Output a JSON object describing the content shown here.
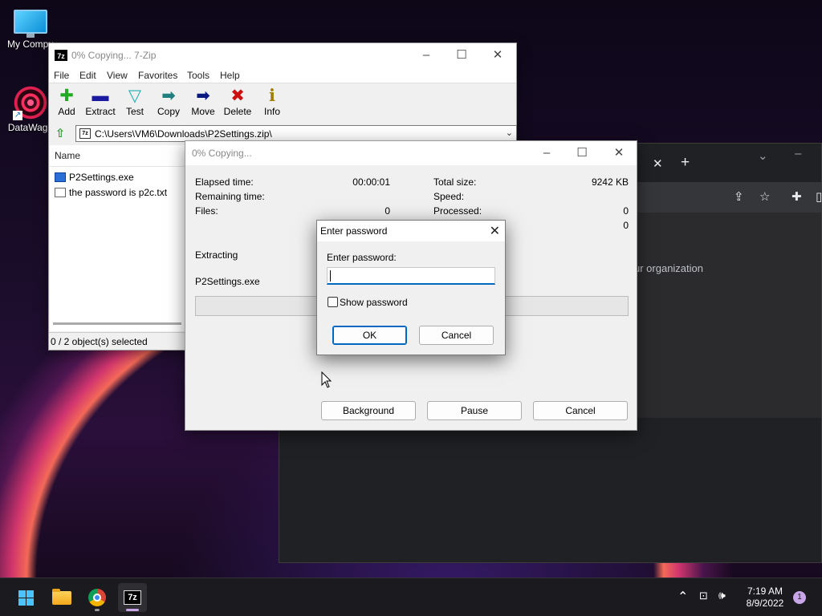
{
  "desktop": {
    "icons": [
      {
        "label": "My Compu",
        "icon": "monitor-icon"
      },
      {
        "label": "DataWago",
        "icon": "app-shortcut-icon"
      }
    ]
  },
  "browser": {
    "text_fragment": "ur organization",
    "icons": [
      "close-icon",
      "new-tab-icon",
      "share-icon",
      "star-icon",
      "extensions-icon"
    ]
  },
  "zip_window": {
    "title": "0% Copying... 7-Zip",
    "app_icon_text": "7z",
    "menu": [
      "File",
      "Edit",
      "View",
      "Favorites",
      "Tools",
      "Help"
    ],
    "toolbar": [
      {
        "label": "Add",
        "icon": "plus-icon",
        "color": "#22aa22"
      },
      {
        "label": "Extract",
        "icon": "minus-icon",
        "color": "#1a1aa0"
      },
      {
        "label": "Test",
        "icon": "check-icon",
        "color": "#20b0b0"
      },
      {
        "label": "Copy",
        "icon": "copy-arrow-icon",
        "color": "#208080"
      },
      {
        "label": "Move",
        "icon": "move-arrow-icon",
        "color": "#0a1a80"
      },
      {
        "label": "Delete",
        "icon": "delete-x-icon",
        "color": "#cc1010"
      },
      {
        "label": "Info",
        "icon": "info-icon",
        "color": "#a08000"
      }
    ],
    "address": "C:\\Users\\VM6\\Downloads\\P2Settings.zip\\",
    "column_header": "Name",
    "files": [
      {
        "name": "P2Settings.exe",
        "type": "exe"
      },
      {
        "name": "the password is p2c.txt",
        "type": "txt"
      }
    ],
    "status": "0 / 2 object(s) selected"
  },
  "progress_dialog": {
    "title": "0% Copying...",
    "elapsed_label": "Elapsed time:",
    "elapsed_value": "00:00:01",
    "remaining_label": "Remaining time:",
    "files_label": "Files:",
    "files_value": "0",
    "total_size_label": "Total size:",
    "total_size_value": "9242 KB",
    "speed_label": "Speed:",
    "processed_label": "Processed:",
    "processed_value": "0",
    "extra_value": "0",
    "operation": "Extracting",
    "current_file": "P2Settings.exe",
    "progress_fraction": 0,
    "buttons": {
      "background": "Background",
      "pause": "Pause",
      "cancel": "Cancel"
    }
  },
  "password_dialog": {
    "title": "Enter password",
    "prompt": "Enter password:",
    "value": "",
    "show_password_label": "Show password",
    "show_password_checked": false,
    "ok": "OK",
    "cancel": "Cancel"
  },
  "taskbar": {
    "apps": [
      "start-icon",
      "file-explorer-icon",
      "chrome-icon",
      "7zip-icon"
    ],
    "zip_icon_text": "7z",
    "time": "7:19 AM",
    "date": "8/9/2022",
    "notification_count": "1"
  }
}
